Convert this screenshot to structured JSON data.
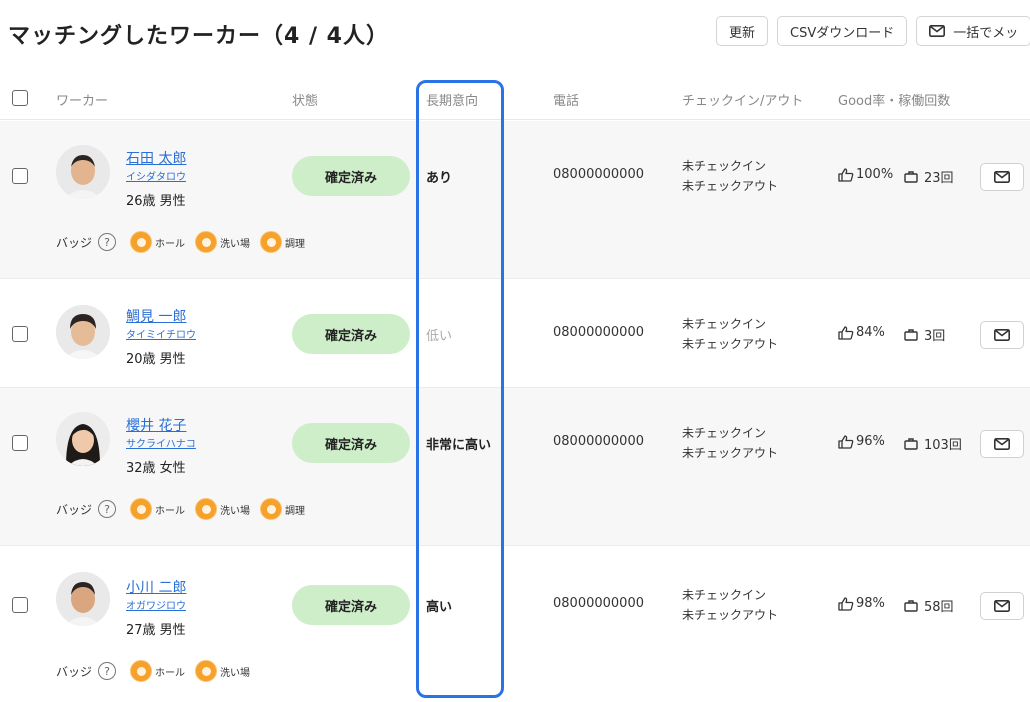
{
  "page": {
    "title": "マッチングしたワーカー（4 / 4人）"
  },
  "toolbar": {
    "refresh_label": "更新",
    "csv_label": "CSVダウンロード",
    "bulk_message_label": "一括でメッ"
  },
  "table": {
    "headers": {
      "worker": "ワーカー",
      "status": "状態",
      "long_term": "長期意向",
      "phone": "電話",
      "checkinout": "チェックイン/アウト",
      "good_rate": "Good率・稼働回数"
    },
    "badge_label": "バッジ",
    "help_glyph": "?",
    "rows": [
      {
        "name": "石田 太郎",
        "kana": "イシダタロウ",
        "age_gender": "26歳 男性",
        "status": "確定済み",
        "long_term": "あり",
        "phone": "08000000000",
        "checkin": "未チェックイン",
        "checkout": "未チェックアウト",
        "good_rate": "100%",
        "work_count": "23回",
        "badges": [
          "ホール",
          "洗い場",
          "調理"
        ]
      },
      {
        "name": "鯛見 一郎",
        "kana": "タイミイチロウ",
        "age_gender": "20歳 男性",
        "status": "確定済み",
        "long_term": "低い",
        "phone": "08000000000",
        "checkin": "未チェックイン",
        "checkout": "未チェックアウト",
        "good_rate": "84%",
        "work_count": "3回",
        "badges": []
      },
      {
        "name": "櫻井 花子",
        "kana": "サクライハナコ",
        "age_gender": "32歳 女性",
        "status": "確定済み",
        "long_term": "非常に高い",
        "phone": "08000000000",
        "checkin": "未チェックイン",
        "checkout": "未チェックアウト",
        "good_rate": "96%",
        "work_count": "103回",
        "badges": [
          "ホール",
          "洗い場",
          "調理"
        ]
      },
      {
        "name": "小川 二郎",
        "kana": "オガワジロウ",
        "age_gender": "27歳 男性",
        "status": "確定済み",
        "long_term": "高い",
        "phone": "08000000000",
        "checkin": "未チェックイン",
        "checkout": "未チェックアウト",
        "good_rate": "98%",
        "work_count": "58回",
        "badges": [
          "ホール",
          "洗い場"
        ]
      }
    ]
  },
  "colors": {
    "link": "#2a6fd6",
    "status_bg": "#cdeec9",
    "highlight": "#2a73e6",
    "badge": "#f5a12b"
  },
  "icons": {
    "mail": "mail-icon",
    "thumbs_up": "thumbs-up-icon",
    "briefcase": "briefcase-icon",
    "help": "help-icon",
    "badge": "badge-icon"
  }
}
